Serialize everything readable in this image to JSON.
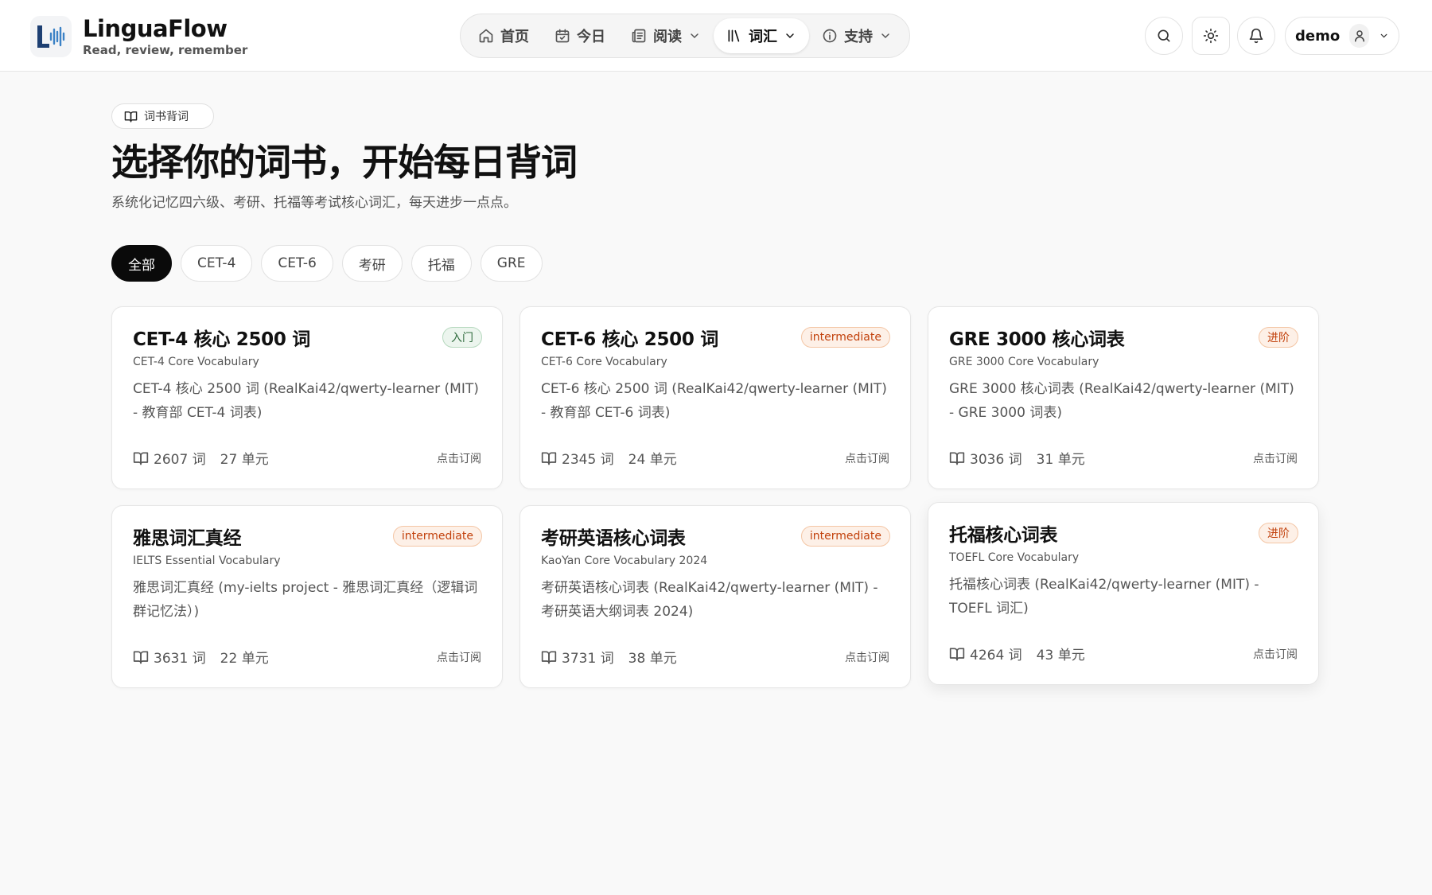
{
  "app": {
    "name": "LinguaFlow",
    "tagline": "Read, review, remember"
  },
  "nav": {
    "items": [
      {
        "label": "首页",
        "icon": "home-icon",
        "active": false
      },
      {
        "label": "今日",
        "icon": "calendar-check-icon",
        "active": false
      },
      {
        "label": "阅读",
        "icon": "newspaper-icon",
        "active": false,
        "has_dropdown": true
      },
      {
        "label": "词汇",
        "icon": "library-icon",
        "active": true,
        "has_dropdown": true
      },
      {
        "label": "支持",
        "icon": "info-icon",
        "active": false,
        "has_dropdown": true
      }
    ]
  },
  "header_actions": [
    "search-icon",
    "sun-icon",
    "bell-icon"
  ],
  "user": {
    "name": "demo"
  },
  "page": {
    "crumb": "词书背词",
    "title": "选择你的词书，开始每日背词",
    "subtitle": "系统化记忆四六级、考研、托福等考试核心词汇，每天进步一点点。"
  },
  "filters": [
    {
      "label": "全部",
      "active": true
    },
    {
      "label": "CET-4",
      "active": false
    },
    {
      "label": "CET-6",
      "active": false
    },
    {
      "label": "考研",
      "active": false
    },
    {
      "label": "托福",
      "active": false
    },
    {
      "label": "GRE",
      "active": false
    }
  ],
  "books": [
    {
      "title": "CET-4 核心 2500 词",
      "subtitle": "CET-4 Core Vocabulary",
      "badge": "入门",
      "description": "CET-4 核心 2500 词 (RealKai42/qwerty-learner (MIT) - 教育部 CET-4 词表)",
      "words": "2607 词",
      "units": "27 单元",
      "action": "点击订阅"
    },
    {
      "title": "CET-6 核心 2500 词",
      "subtitle": "CET-6 Core Vocabulary",
      "badge": "intermediate",
      "description": "CET-6 核心 2500 词 (RealKai42/qwerty-learner (MIT) - 教育部 CET-6 词表)",
      "words": "2345 词",
      "units": "24 单元",
      "action": "点击订阅"
    },
    {
      "title": "GRE 3000 核心词表",
      "subtitle": "GRE 3000 Core Vocabulary",
      "badge": "进阶",
      "description": "GRE 3000 核心词表 (RealKai42/qwerty-learner (MIT) - GRE 3000 词表)",
      "words": "3036 词",
      "units": "31 单元",
      "action": "点击订阅"
    },
    {
      "title": "雅思词汇真经",
      "subtitle": "IELTS Essential Vocabulary",
      "badge": "intermediate",
      "description": "雅思词汇真经 (my-ielts project - 雅思词汇真经（逻辑词群记忆法）)",
      "words": "3631 词",
      "units": "22 单元",
      "action": "点击订阅"
    },
    {
      "title": "考研英语核心词表",
      "subtitle": "KaoYan Core Vocabulary 2024",
      "badge": "intermediate",
      "description": "考研英语核心词表 (RealKai42/qwerty-learner (MIT) - 考研英语大纲词表 2024)",
      "words": "3731 词",
      "units": "38 单元",
      "action": "点击订阅"
    },
    {
      "title": "托福核心词表",
      "subtitle": "TOEFL Core Vocabulary",
      "badge": "进阶",
      "description": "托福核心词表 (RealKai42/qwerty-learner (MIT) - TOEFL 词汇)",
      "words": "4264 词",
      "units": "43 单元",
      "action": "点击订阅"
    }
  ],
  "colors": {
    "accent_dark": "#0a0a0a",
    "badge_beginner": "#2f6b3d",
    "badge_warm": "#c2410c",
    "logo_blue": "#1e5fa8"
  }
}
